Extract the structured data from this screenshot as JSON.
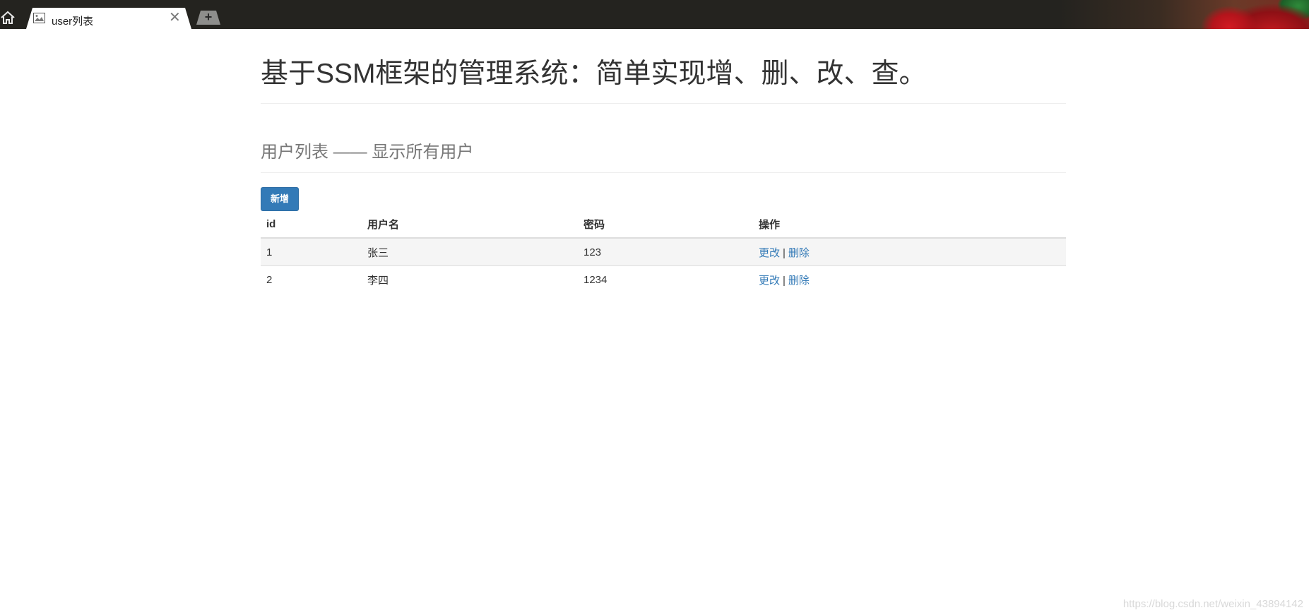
{
  "browser": {
    "tab_title": "user列表",
    "close_glyph": "✕",
    "new_tab_glyph": "+"
  },
  "page": {
    "title": "基于SSM框架的管理系统：简单实现增、删、改、查。",
    "section_title": "用户列表 —— 显示所有用户",
    "add_button_label": "新增"
  },
  "table": {
    "headers": [
      "id",
      "用户名",
      "密码",
      "操作"
    ],
    "rows": [
      {
        "id": "1",
        "username": "张三",
        "password": "123",
        "edit": "更改",
        "delete": "删除"
      },
      {
        "id": "2",
        "username": "李四",
        "password": "1234",
        "edit": "更改",
        "delete": "删除"
      }
    ],
    "action_separator": "|"
  },
  "watermark": "https://blog.csdn.net/weixin_43894142",
  "colors": {
    "accent": "#337ab7",
    "tabstrip": "#24231f"
  }
}
